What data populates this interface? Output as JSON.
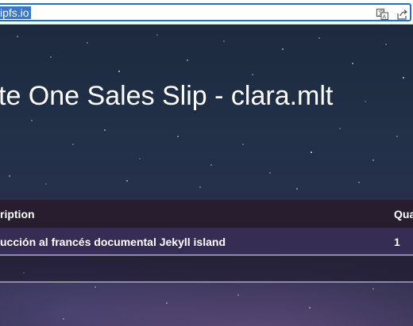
{
  "browser": {
    "url_text": "ipfs.io",
    "translate_icon": "translate-icon",
    "share_icon": "share-icon"
  },
  "page": {
    "title": "te One Sales Slip - clara.mlt",
    "table": {
      "headers": {
        "description": "ription",
        "quantity": "Qua"
      },
      "rows": [
        {
          "description": "ucción al francés documental Jekyll island",
          "quantity": "1"
        }
      ]
    }
  }
}
